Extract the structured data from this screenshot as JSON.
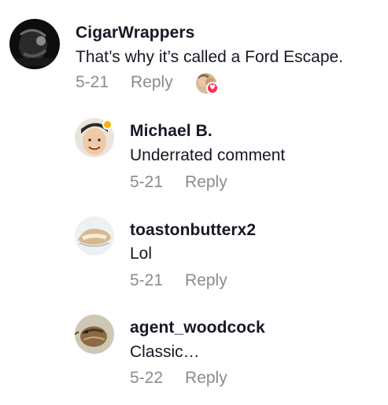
{
  "comments": [
    {
      "username": "CigarWrappers",
      "text": "That’s why it’s called a Ford Escape.",
      "date": "5-21",
      "reply_label": "Reply",
      "liked_by_creator": true
    },
    {
      "username": "Michael B.",
      "text": "Underrated comment",
      "date": "5-21",
      "reply_label": "Reply"
    },
    {
      "username": "toastonbutterx2",
      "text": "Lol",
      "date": "5-21",
      "reply_label": "Reply"
    },
    {
      "username": "agent_woodcock",
      "text": "Classic…",
      "date": "5-22",
      "reply_label": "Reply"
    }
  ],
  "icons": {
    "creator_like_icon": "heart-icon"
  },
  "colors": {
    "heart": "#fe2c55",
    "meta_text": "#8a8b91",
    "primary_text": "#161823"
  }
}
